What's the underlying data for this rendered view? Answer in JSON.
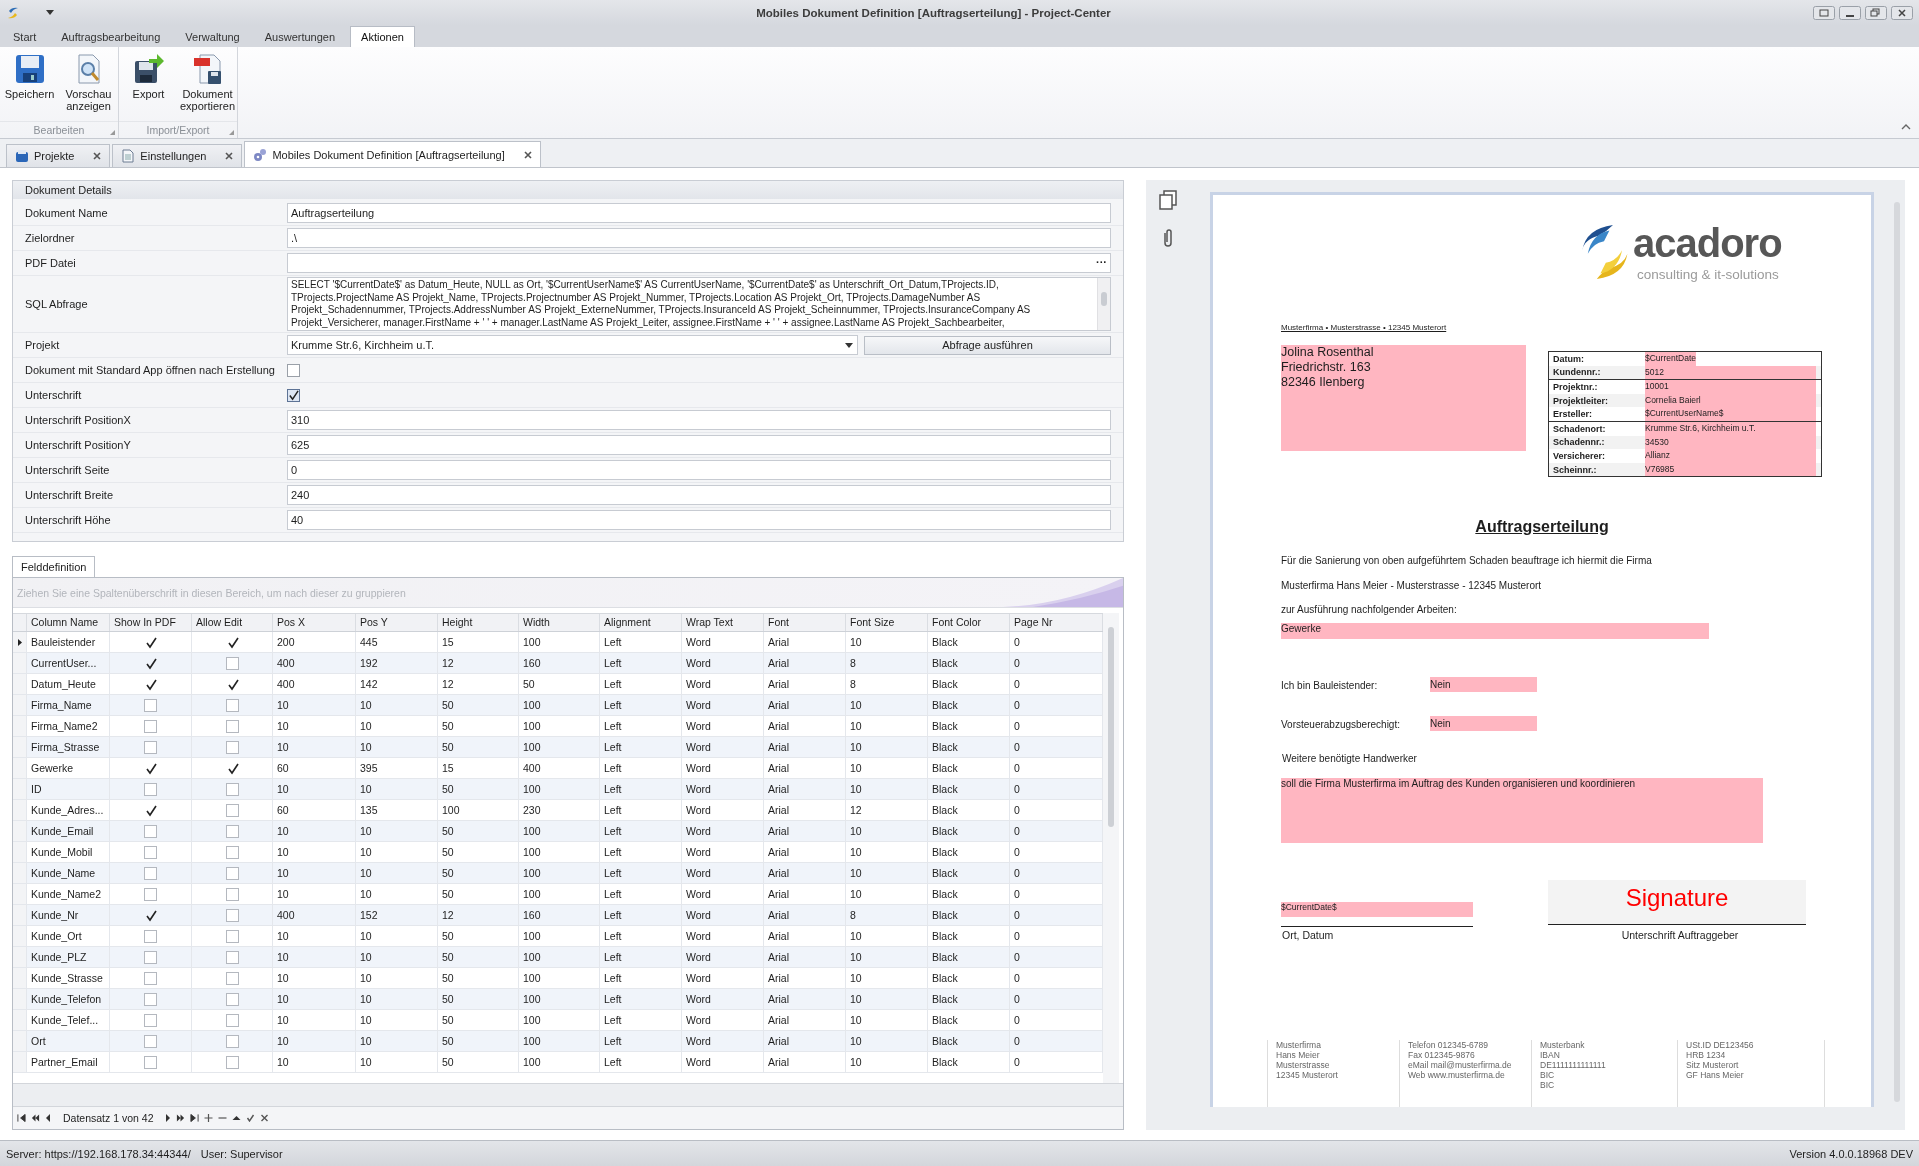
{
  "window": {
    "title": "Mobiles Dokument Definition [Auftragserteilung] - Project-Center"
  },
  "ribbon": {
    "tabs": [
      {
        "label": "Start",
        "selected": false
      },
      {
        "label": "Auftragsbearbeitung",
        "selected": false
      },
      {
        "label": "Verwaltung",
        "selected": false
      },
      {
        "label": "Auswertungen",
        "selected": false
      },
      {
        "label": "Aktionen",
        "selected": true
      }
    ],
    "groups": [
      {
        "label": "Bearbeiten",
        "buttons": [
          {
            "label": "Speichern"
          },
          {
            "label": "Vorschau anzeigen"
          }
        ]
      },
      {
        "label": "Import/Export",
        "buttons": [
          {
            "label": "Export"
          },
          {
            "label": "Dokument exportieren"
          }
        ]
      }
    ]
  },
  "document_tabs": [
    {
      "label": "Projekte",
      "selected": false
    },
    {
      "label": "Einstellungen",
      "selected": false
    },
    {
      "label": "Mobiles Dokument Definition [Auftragserteilung]",
      "selected": true
    }
  ],
  "details": {
    "title": "Dokument Details",
    "fields": [
      {
        "kind": "text",
        "label": "Dokument Name",
        "value": "Auftragserteilung"
      },
      {
        "kind": "text",
        "label": "Zielordner",
        "value": ".\\"
      },
      {
        "kind": "file",
        "label": "PDF Datei",
        "browse_label": "···"
      },
      {
        "kind": "memo",
        "label": "SQL Abfrage",
        "lines": [
          "SELECT '$CurrentDate$' as Datum_Heute, NULL as Ort, '$CurrentUserName$' AS CurrentUserName, '$CurrentDate$' as Unterschrift_Ort_Datum,TProjects.ID,",
          "TProjects.ProjectName AS Projekt_Name, TProjects.Projectnumber AS Projekt_Nummer, TProjects.Location AS Projekt_Ort, TProjects.DamageNumber AS",
          "Projekt_Schadennummer, TProjects.AddressNumber AS Projekt_ExterneNummer, TProjects.InsuranceId AS Projekt_Scheinnummer, TProjects.InsuranceCompany AS",
          "Projekt_Versicherer, manager.FirstName + ' ' + manager.LastName AS Projekt_Leiter, assignee.FirstName + ' ' + assignee.LastName AS Projekt_Sachbearbeiter,"
        ]
      },
      {
        "kind": "combo",
        "label": "Projekt",
        "value": "Krumme Str.6, Kirchheim u.T.",
        "action_button": "Abfrage ausführen"
      },
      {
        "kind": "checkbox",
        "label": "Dokument mit Standard App öffnen nach Erstellung",
        "checked": false
      },
      {
        "kind": "checkbox",
        "label": "Unterschrift",
        "checked": true
      },
      {
        "kind": "text",
        "label": "Unterschrift PositionX",
        "value": "310"
      },
      {
        "kind": "text",
        "label": "Unterschrift PositionY",
        "value": "625"
      },
      {
        "kind": "text",
        "label": "Unterschrift Seite",
        "value": "0"
      },
      {
        "kind": "text",
        "label": "Unterschrift Breite",
        "value": "240"
      },
      {
        "kind": "text",
        "label": "Unterschrift Höhe",
        "value": "40"
      }
    ]
  },
  "grid": {
    "tab": "Felddefinition",
    "group_hint": "Ziehen Sie eine Spaltenüberschrift in diesen Bereich, um nach dieser zu gruppieren",
    "columns": [
      "Column Name",
      "Show In PDF",
      "Allow Edit",
      "Pos X",
      "Pos Y",
      "Height",
      "Width",
      "Alignment",
      "Wrap Text",
      "Font",
      "Font Size",
      "Font Color",
      "Page Nr"
    ],
    "rows": [
      {
        "selected": true,
        "column_name": "Bauleistender",
        "show_in_pdf": true,
        "allow_edit": true,
        "values": [
          "200",
          "445",
          "15",
          "100",
          "Left",
          "Word",
          "Arial",
          "10",
          "Black",
          "0"
        ]
      },
      {
        "selected": false,
        "column_name": "CurrentUser...",
        "show_in_pdf": true,
        "allow_edit": false,
        "values": [
          "400",
          "192",
          "12",
          "160",
          "Left",
          "Word",
          "Arial",
          "8",
          "Black",
          "0"
        ]
      },
      {
        "selected": false,
        "column_name": "Datum_Heute",
        "show_in_pdf": true,
        "allow_edit": true,
        "values": [
          "400",
          "142",
          "12",
          "50",
          "Left",
          "Word",
          "Arial",
          "8",
          "Black",
          "0"
        ]
      },
      {
        "selected": false,
        "column_name": "Firma_Name",
        "show_in_pdf": false,
        "allow_edit": false,
        "values": [
          "10",
          "10",
          "50",
          "100",
          "Left",
          "Word",
          "Arial",
          "10",
          "Black",
          "0"
        ]
      },
      {
        "selected": false,
        "column_name": "Firma_Name2",
        "show_in_pdf": false,
        "allow_edit": false,
        "values": [
          "10",
          "10",
          "50",
          "100",
          "Left",
          "Word",
          "Arial",
          "10",
          "Black",
          "0"
        ]
      },
      {
        "selected": false,
        "column_name": "Firma_Strasse",
        "show_in_pdf": false,
        "allow_edit": false,
        "values": [
          "10",
          "10",
          "50",
          "100",
          "Left",
          "Word",
          "Arial",
          "10",
          "Black",
          "0"
        ]
      },
      {
        "selected": false,
        "column_name": "Gewerke",
        "show_in_pdf": true,
        "allow_edit": true,
        "values": [
          "60",
          "395",
          "15",
          "400",
          "Left",
          "Word",
          "Arial",
          "10",
          "Black",
          "0"
        ]
      },
      {
        "selected": false,
        "column_name": "ID",
        "show_in_pdf": false,
        "allow_edit": false,
        "values": [
          "10",
          "10",
          "50",
          "100",
          "Left",
          "Word",
          "Arial",
          "10",
          "Black",
          "0"
        ]
      },
      {
        "selected": false,
        "column_name": "Kunde_Adres...",
        "show_in_pdf": true,
        "allow_edit": false,
        "values": [
          "60",
          "135",
          "100",
          "230",
          "Left",
          "Word",
          "Arial",
          "12",
          "Black",
          "0"
        ]
      },
      {
        "selected": false,
        "column_name": "Kunde_Email",
        "show_in_pdf": false,
        "allow_edit": false,
        "values": [
          "10",
          "10",
          "50",
          "100",
          "Left",
          "Word",
          "Arial",
          "10",
          "Black",
          "0"
        ]
      },
      {
        "selected": false,
        "column_name": "Kunde_Mobil",
        "show_in_pdf": false,
        "allow_edit": false,
        "values": [
          "10",
          "10",
          "50",
          "100",
          "Left",
          "Word",
          "Arial",
          "10",
          "Black",
          "0"
        ]
      },
      {
        "selected": false,
        "column_name": "Kunde_Name",
        "show_in_pdf": false,
        "allow_edit": false,
        "values": [
          "10",
          "10",
          "50",
          "100",
          "Left",
          "Word",
          "Arial",
          "10",
          "Black",
          "0"
        ]
      },
      {
        "selected": false,
        "column_name": "Kunde_Name2",
        "show_in_pdf": false,
        "allow_edit": false,
        "values": [
          "10",
          "10",
          "50",
          "100",
          "Left",
          "Word",
          "Arial",
          "10",
          "Black",
          "0"
        ]
      },
      {
        "selected": false,
        "column_name": "Kunde_Nr",
        "show_in_pdf": true,
        "allow_edit": false,
        "values": [
          "400",
          "152",
          "12",
          "160",
          "Left",
          "Word",
          "Arial",
          "8",
          "Black",
          "0"
        ]
      },
      {
        "selected": false,
        "column_name": "Kunde_Ort",
        "show_in_pdf": false,
        "allow_edit": false,
        "values": [
          "10",
          "10",
          "50",
          "100",
          "Left",
          "Word",
          "Arial",
          "10",
          "Black",
          "0"
        ]
      },
      {
        "selected": false,
        "column_name": "Kunde_PLZ",
        "show_in_pdf": false,
        "allow_edit": false,
        "values": [
          "10",
          "10",
          "50",
          "100",
          "Left",
          "Word",
          "Arial",
          "10",
          "Black",
          "0"
        ]
      },
      {
        "selected": false,
        "column_name": "Kunde_Strasse",
        "show_in_pdf": false,
        "allow_edit": false,
        "values": [
          "10",
          "10",
          "50",
          "100",
          "Left",
          "Word",
          "Arial",
          "10",
          "Black",
          "0"
        ]
      },
      {
        "selected": false,
        "column_name": "Kunde_Telefon",
        "show_in_pdf": false,
        "allow_edit": false,
        "values": [
          "10",
          "10",
          "50",
          "100",
          "Left",
          "Word",
          "Arial",
          "10",
          "Black",
          "0"
        ]
      },
      {
        "selected": false,
        "column_name": "Kunde_Telef...",
        "show_in_pdf": false,
        "allow_edit": false,
        "values": [
          "10",
          "10",
          "50",
          "100",
          "Left",
          "Word",
          "Arial",
          "10",
          "Black",
          "0"
        ]
      },
      {
        "selected": false,
        "column_name": "Ort",
        "show_in_pdf": false,
        "allow_edit": false,
        "values": [
          "10",
          "10",
          "50",
          "100",
          "Left",
          "Word",
          "Arial",
          "10",
          "Black",
          "0"
        ]
      },
      {
        "selected": false,
        "column_name": "Partner_Email",
        "show_in_pdf": false,
        "allow_edit": false,
        "values": [
          "10",
          "10",
          "50",
          "100",
          "Left",
          "Word",
          "Arial",
          "10",
          "Black",
          "0"
        ]
      }
    ],
    "navigator": "Datensatz 1 von 42"
  },
  "preview": {
    "logo": {
      "name": "acadoro",
      "tagline": "consulting & it-solutions"
    },
    "sender_line": "Musterfirma • Musterstrasse • 12345 Musterort",
    "address": [
      "Jolina Rosenthal",
      "Friedrichstr. 163",
      "82346 Ilenberg"
    ],
    "info_groups": [
      [
        {
          "label": "Datum:",
          "value": "$CurrentDate"
        },
        {
          "label": "Kundennr.:",
          "value": "5012"
        }
      ],
      [
        {
          "label": "Projektnr.:",
          "value": "10001"
        },
        {
          "label": "Projektleiter:",
          "value": "Cornelia Baierl"
        },
        {
          "label": "Ersteller:",
          "value": "$CurrentUserName$"
        }
      ],
      [
        {
          "label": "Schadenort:",
          "value": "Krumme Str.6, Kirchheim u.T."
        },
        {
          "label": "Schadennr.:",
          "value": "34530"
        },
        {
          "label": "Versicherer:",
          "value": "Allianz"
        },
        {
          "label": "Scheinnr.:",
          "value": "V76985"
        }
      ]
    ],
    "heading": "Auftragserteilung",
    "intro": [
      "Für die Sanierung von oben aufgeführtem Schaden beauftrage ich hiermit die Firma",
      "Musterfirma Hans Meier - Musterstrasse - 12345 Musterort",
      "zur Ausführung nachfolgender Arbeiten:"
    ],
    "gewerke": "Gewerke",
    "questions": [
      {
        "label": "Ich bin Bauleistender:",
        "value": "Nein"
      },
      {
        "label": "Vorsteuerabzugsberechigt:",
        "value": "Nein"
      }
    ],
    "extra_label": "Weitere benötigte Handwerker",
    "extra_value": "soll die Firma Musterfirma im Auftrag des Kunden organisieren und koordinieren",
    "date_value": "$CurrentDate$",
    "date_label": "Ort, Datum",
    "signature": "Signature",
    "signature_label": "Unterschrift Auftraggeber",
    "footer": [
      [
        "Musterfirma",
        "Hans Meier",
        "Musterstrasse",
        "12345 Musterort"
      ],
      [
        "Telefon 012345-6789",
        "Fax 012345-9876",
        "eMail mail@musterfirma.de",
        "Web www.musterfirma.de"
      ],
      [
        "Musterbank",
        "IBAN",
        "DE1111111111111",
        "BIC",
        "BIC"
      ],
      [
        "USt.ID DE123456",
        "HRB 1234",
        "Sitz  Musterort",
        "GF  Hans Meier"
      ]
    ]
  },
  "status_bar": {
    "server": "Server: https://192.168.178.34:44344/",
    "user": "User: Supervisor",
    "version": "Version 4.0.0.18968 DEV"
  }
}
